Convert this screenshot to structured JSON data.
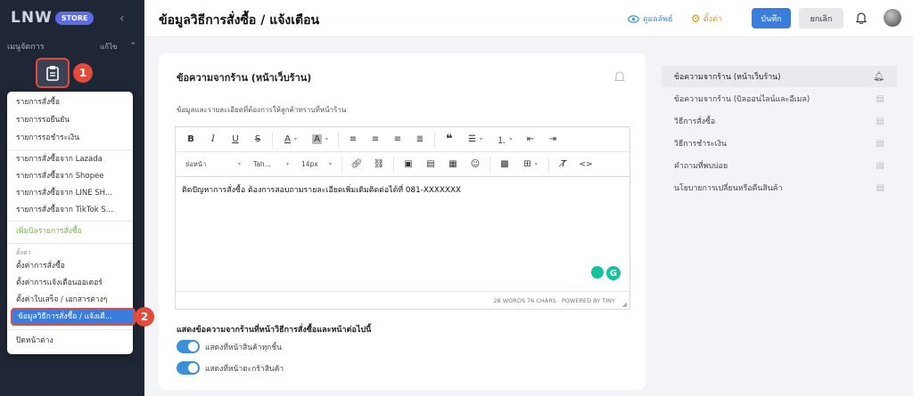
{
  "sidebar": {
    "logo_text": "LNW",
    "logo_badge": "STORE",
    "menu_header": "เมนูจัดการ",
    "menu_edit": "แก้ไข",
    "step1": "1",
    "step2": "2",
    "dropdown": {
      "group1": [
        "รายการสั่งซื้อ",
        "รายการรอยืนยัน",
        "รายการรอชำระเงิน"
      ],
      "group2": [
        "รายการสั่งซื้อจาก Lazada",
        "รายการสั่งซื้อจาก Shopee",
        "รายการสั่งซื้อจาก LINE SH...",
        "รายการสั่งซื้อจาก TikTok S..."
      ],
      "add_order": "เพิ่มบิลรายการสั่งซื้อ",
      "settings_label": "ตั้งค่า",
      "group3": [
        "ตั้งค่าการสั่งซื้อ",
        "ตั้งค่าการแจ้งเตือนออเดอร์",
        "ตั้งค่าใบเสร็จ / เอกสารต่างๆ"
      ],
      "active_item": "ข้อมูลวิธีการสั่งซื้อ / แจ้งเตื...",
      "close_window": "ปิดหน้าต่าง"
    }
  },
  "topbar": {
    "title": "ข้อมูลวิธีการสั่งซื้อ / แจ้งเตือน",
    "preview": "ดูผลลัพธ์",
    "settings": "ตั้งค่า",
    "save": "บันทึก",
    "cancel": "ยกเลิก"
  },
  "card": {
    "title": "ข้อความจากร้าน (หน้าเว็บร้าน)",
    "subtitle": "ข้อมูลและรายละเอียดที่ต้องการให้ลูกค้าทราบที่หน้าร้าน",
    "editor": {
      "toolbar1": [
        "B",
        "I",
        "U",
        "S"
      ],
      "format_select": "ย่อหน้า",
      "font_select": "Tah...",
      "size_select": "14px",
      "content": "ติดปัญหาการสั่งซื้อ ต้องการสอบถามรายละเอียดเพิ่มเติมติดต่อได้ที่ 081-XXXXXXX",
      "word_count": "28 WORDS 76 CHARS",
      "powered": "POWERED BY TINY"
    },
    "section_title": "แสดงข้อความจากร้านที่หน้าวิธีการสั่งซื้อและหน้าต่อไปนี้",
    "toggles": [
      {
        "label": "แสดงที่หน้าสินค้าทุกชิ้น",
        "on": true
      },
      {
        "label": "แสดงที่หน้าตะกร้าสินค้า",
        "on": true
      }
    ]
  },
  "right_list": [
    "ข้อความจากร้าน (หน้าเว็บร้าน)",
    "ข้อความจากร้าน (บิลออนไลน์และอีเมล)",
    "วิธีการสั่งซื้อ",
    "วิธีการชำระเงิน",
    "คำถามที่พบบ่อย",
    "นโยบายการเปลี่ยนหรือคืนสินค้า"
  ],
  "colors": {
    "sidebar_bg": "#1f2635",
    "accent_blue": "#3b7ddd",
    "highlight_red": "#e34b3c",
    "settings_orange": "#e8901a",
    "add_green": "#6fbf3d"
  }
}
